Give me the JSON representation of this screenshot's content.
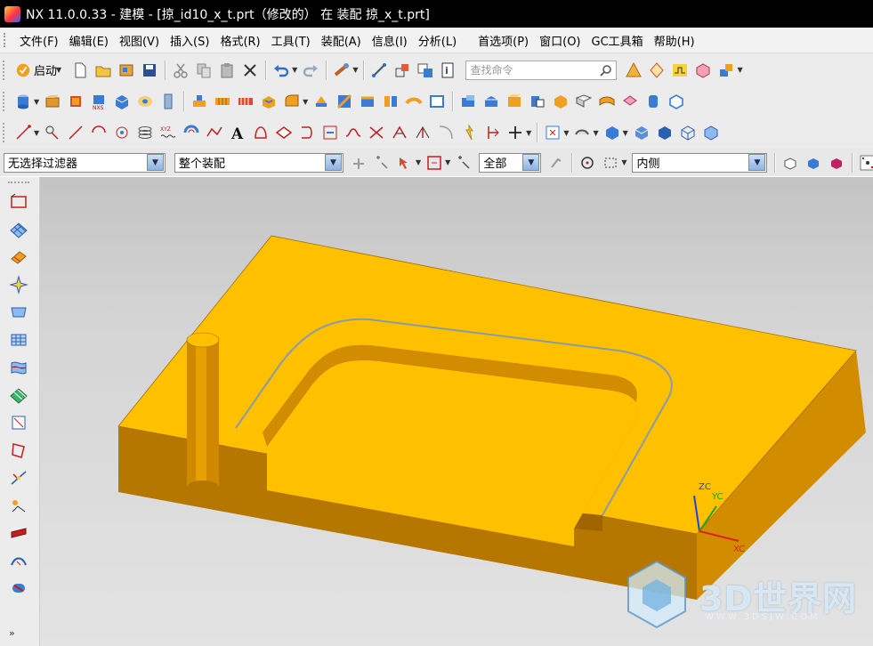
{
  "window": {
    "title": "NX 11.0.0.33 - 建模 - [掠_id10_x_t.prt（修改的） 在 装配 掠_x_t.prt]"
  },
  "menubar": {
    "items": [
      "文件(F)",
      "编辑(E)",
      "视图(V)",
      "插入(S)",
      "格式(R)",
      "工具(T)",
      "装配(A)",
      "信息(I)",
      "分析(L)"
    ],
    "items_right": [
      "首选项(P)",
      "窗口(O)",
      "GC工具箱",
      "帮助(H)"
    ]
  },
  "toolbar": {
    "start_label": "启动",
    "search_placeholder": "查找命令"
  },
  "selection_bar": {
    "filter_value": "无选择过滤器",
    "scope_value": "整个装配",
    "layer_value": "全部",
    "position_value": "内侧"
  },
  "viewport": {
    "part_color": "#ffc000",
    "background_top": "#c3c3c3",
    "background_bottom": "#e3e3e3",
    "triad": {
      "zc": "ZC",
      "yc": "YC",
      "xc": "XC"
    }
  },
  "watermark": {
    "brand": "3D世界网",
    "url": "WWW.3DSJW.COM"
  }
}
